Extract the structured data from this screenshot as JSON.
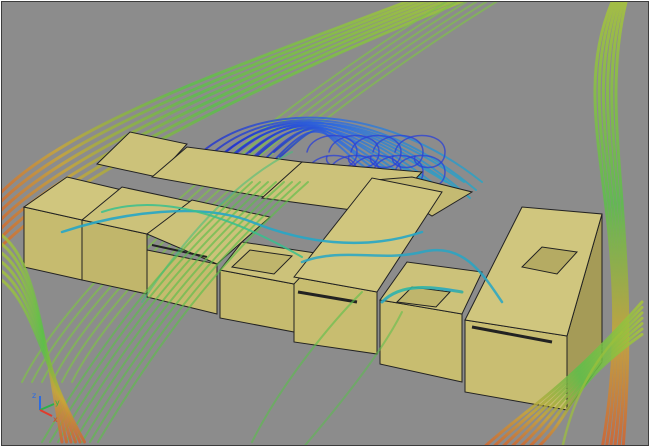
{
  "viewport": {
    "background": "#8c8c8c",
    "border": "#3c3c3c"
  },
  "buildings": {
    "roof_color": "#ccc27a",
    "wall_color": "#c9be72",
    "shadow_color": "#a59b57"
  },
  "streamlines": {
    "colormap": [
      "#1f2fd0",
      "#2f6ee0",
      "#26a6c6",
      "#37c08e",
      "#58c04a",
      "#9cc03a",
      "#c9a637",
      "#d4612d"
    ]
  },
  "axes_triad": {
    "icon": "axis-triad-icon",
    "x_label": "x",
    "y_label": "y",
    "z_label": "z",
    "x_color": "#e23b2b",
    "y_color": "#2bb34a",
    "z_color": "#2b6be2"
  }
}
